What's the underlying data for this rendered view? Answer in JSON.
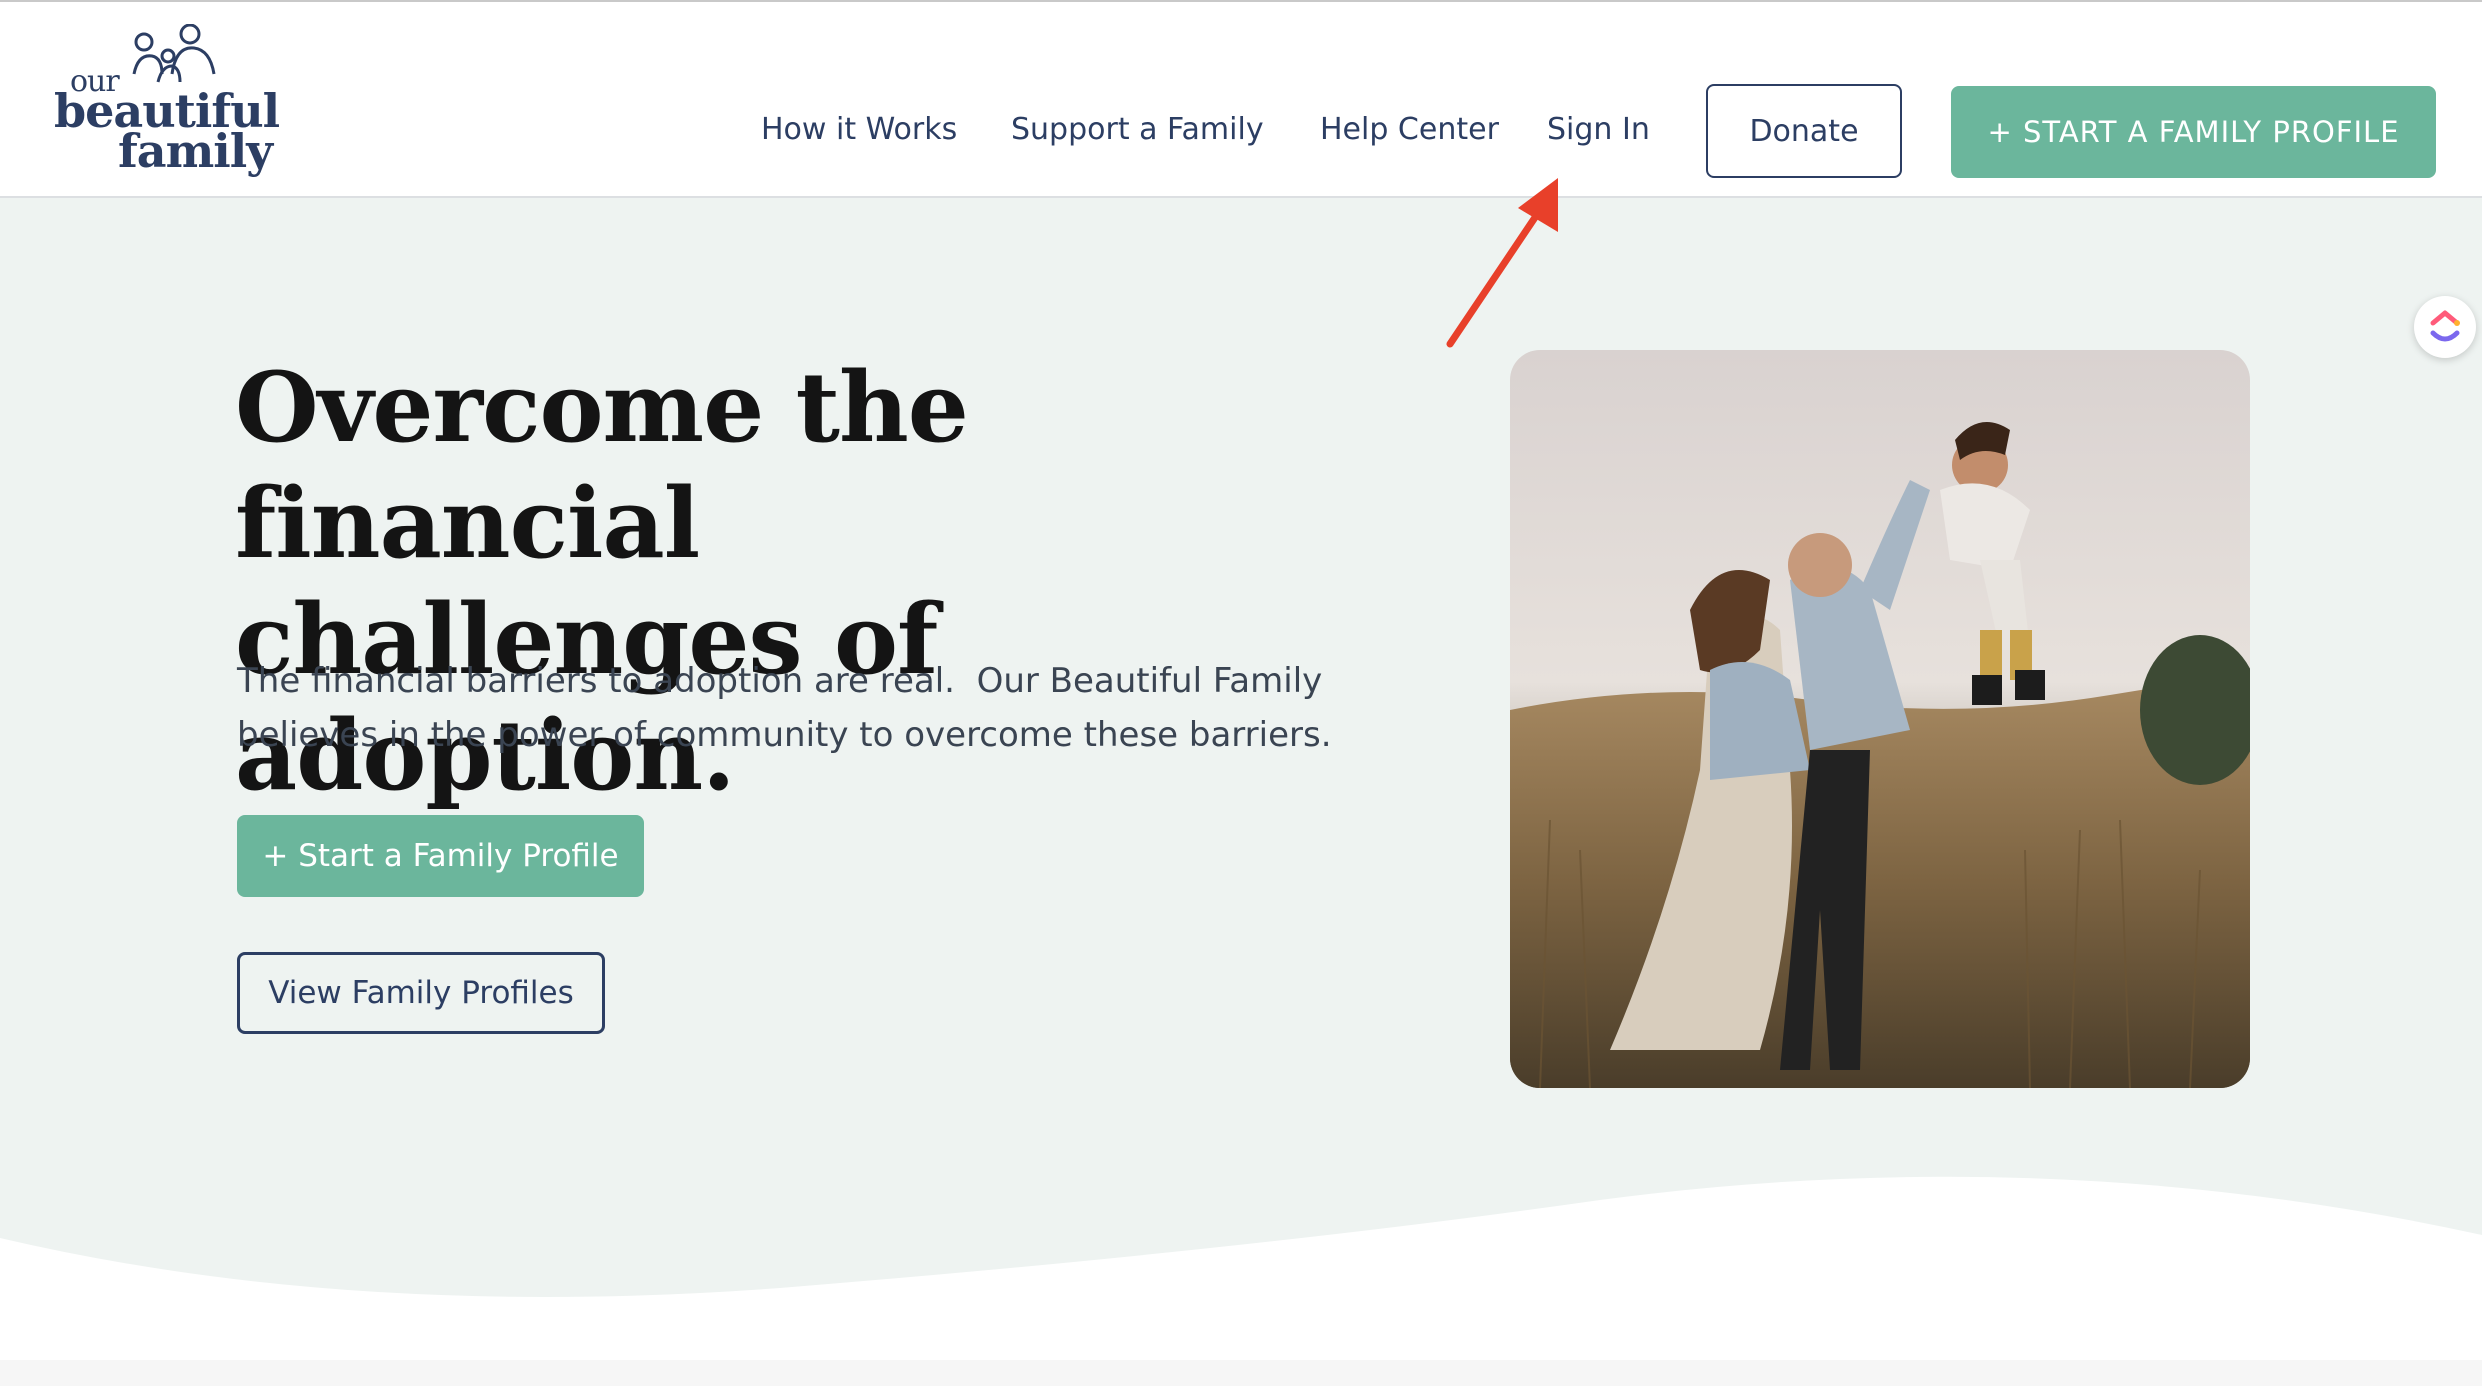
{
  "logo": {
    "line1": "our",
    "line2": "beautiful",
    "line3": "family"
  },
  "nav": {
    "items": [
      {
        "label": "How it Works"
      },
      {
        "label": "Support a Family"
      },
      {
        "label": "Help Center"
      },
      {
        "label": "Sign In"
      }
    ],
    "donate_label": "Donate",
    "start_profile_label": "+ START A FAMILY PROFILE"
  },
  "hero": {
    "title_line1": "Overcome the financial",
    "title_line2": "challenges of adoption.",
    "subtitle_line1": "The financial barriers to adoption are real.  Our Beautiful Family",
    "subtitle_line2": "believes in the power of community to overcome these barriers.",
    "primary_button": "+ Start a Family Profile",
    "secondary_button": "View Family Profiles"
  },
  "colors": {
    "brand_navy": "#2c3e63",
    "brand_green": "#6bb69c",
    "hero_bg": "#eef3f1",
    "annotation_arrow": "#e8402a"
  },
  "icons": {
    "logo_mark": "family-figures-icon",
    "side_widget": "clickup-icon",
    "annotation": "red-arrow"
  }
}
